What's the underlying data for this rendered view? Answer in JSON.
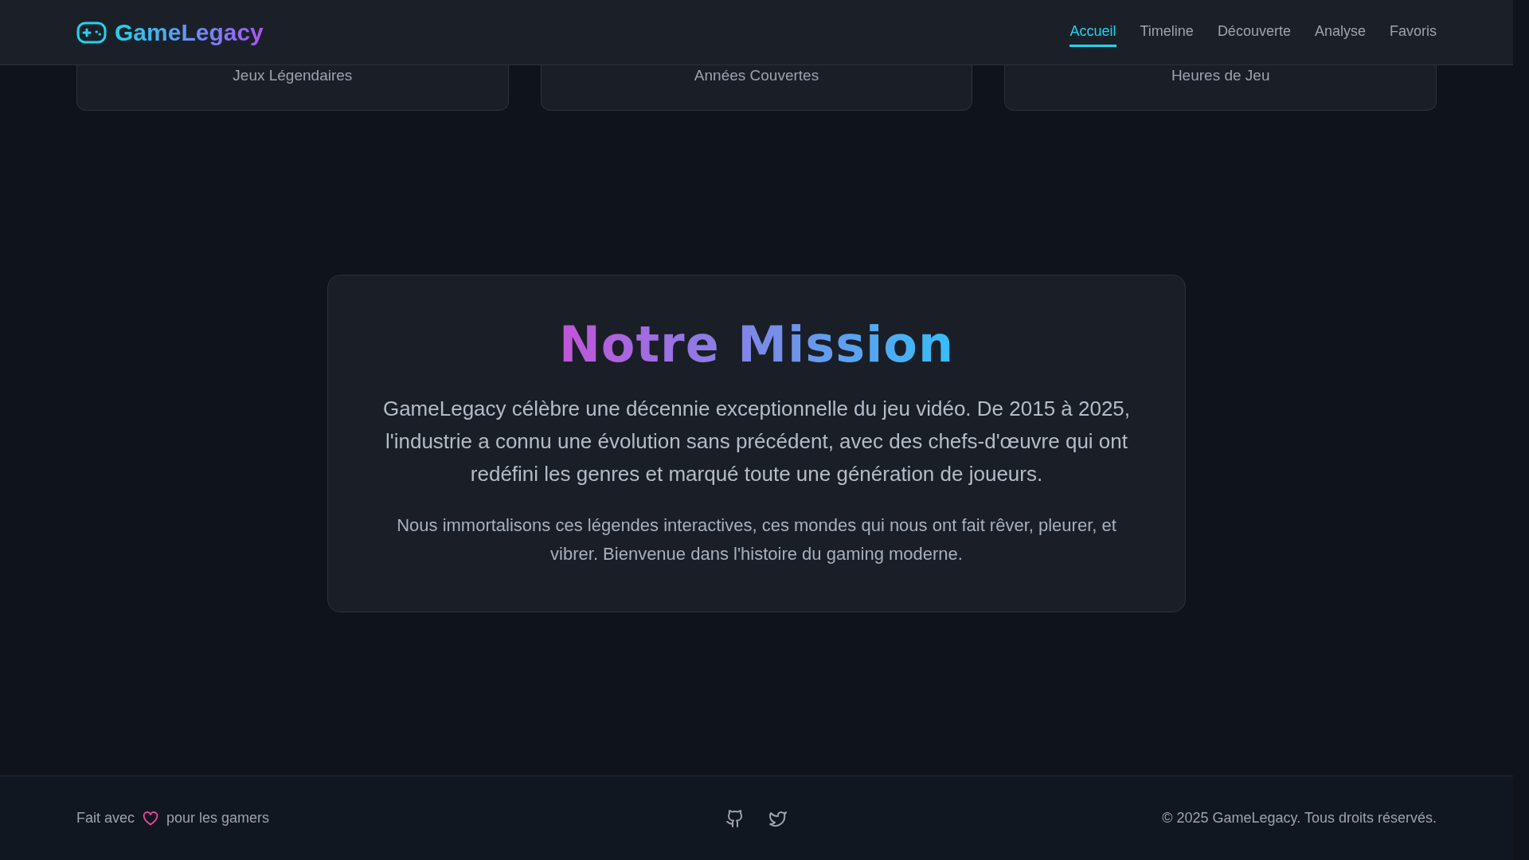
{
  "header": {
    "logo": "GameLegacy",
    "nav": [
      {
        "label": "Accueil",
        "selected": true
      },
      {
        "label": "Timeline",
        "selected": false
      },
      {
        "label": "Découverte",
        "selected": false
      },
      {
        "label": "Analyse",
        "selected": false
      },
      {
        "label": "Favoris",
        "selected": false
      }
    ]
  },
  "stats": [
    {
      "label": "Jeux Légendaires"
    },
    {
      "label": "Années Couvertes"
    },
    {
      "label": "Heures de Jeu"
    }
  ],
  "mission": {
    "title": "Notre Mission",
    "paragraphs": [
      "GameLegacy célèbre une décennie exceptionnelle du jeu vidéo. De 2015 à 2025, l'industrie a connu une évolution sans précédent, avec des chefs-d'œuvre qui ont redéfini les genres et marqué toute une génération de joueurs.",
      "Nous immortalisons ces légendes interactives, ces mondes qui nous ont fait rêver, pleurer, et vibrer. Bienvenue dans l'histoire du gaming moderne."
    ]
  },
  "footer": {
    "made_before": "Fait avec",
    "made_after": "pour les gamers",
    "copyright": "© 2025 GameLegacy. Tous droits réservés."
  }
}
